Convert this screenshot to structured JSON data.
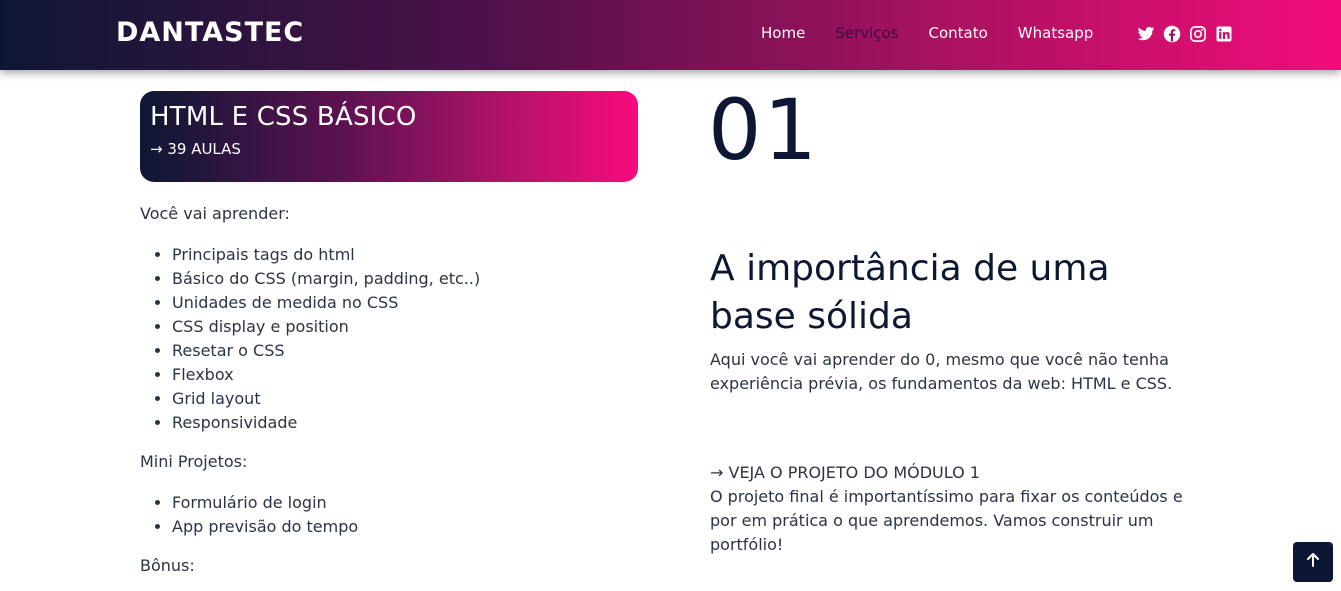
{
  "header": {
    "brand": "DANTASTEC",
    "nav": [
      {
        "label": "Home",
        "active": false
      },
      {
        "label": "Serviços",
        "active": true
      },
      {
        "label": "Contato",
        "active": false
      },
      {
        "label": "Whatsapp",
        "active": false
      }
    ],
    "social_icons": [
      "twitter-icon",
      "facebook-icon",
      "instagram-icon",
      "linkedin-icon"
    ]
  },
  "module": {
    "title": "HTML E CSS BÁSICO",
    "lessons": "→ 39 AULAS",
    "number": "01",
    "headline": "A importância de uma base sólida",
    "intro": "Aqui você vai aprender do 0, mesmo que você não tenha experiência prévia, os fundamentos da web: HTML e CSS.",
    "project_link": "→ VEJA O PROJETO DO MÓDULO 1",
    "project_desc": "O projeto final é importantíssimo para fixar os conteúdos e por em prática o que aprendemos. Vamos construir um portfólio!"
  },
  "content": {
    "learn_label": "Você vai aprender:",
    "learn_items": [
      "Principais tags do html",
      "Básico do CSS (margin, padding, etc..)",
      "Unidades de medida no CSS",
      "CSS display e position",
      "Resetar o CSS",
      "Flexbox",
      "Grid layout",
      "Responsividade"
    ],
    "projects_label": "Mini Projetos:",
    "projects_items": [
      "Formulário de login",
      "App previsão do tempo"
    ],
    "bonus_label": "Bônus:"
  },
  "colors": {
    "navy": "#0d1733",
    "pink": "#f20c7a",
    "active_nav": "#3a0c3a"
  }
}
